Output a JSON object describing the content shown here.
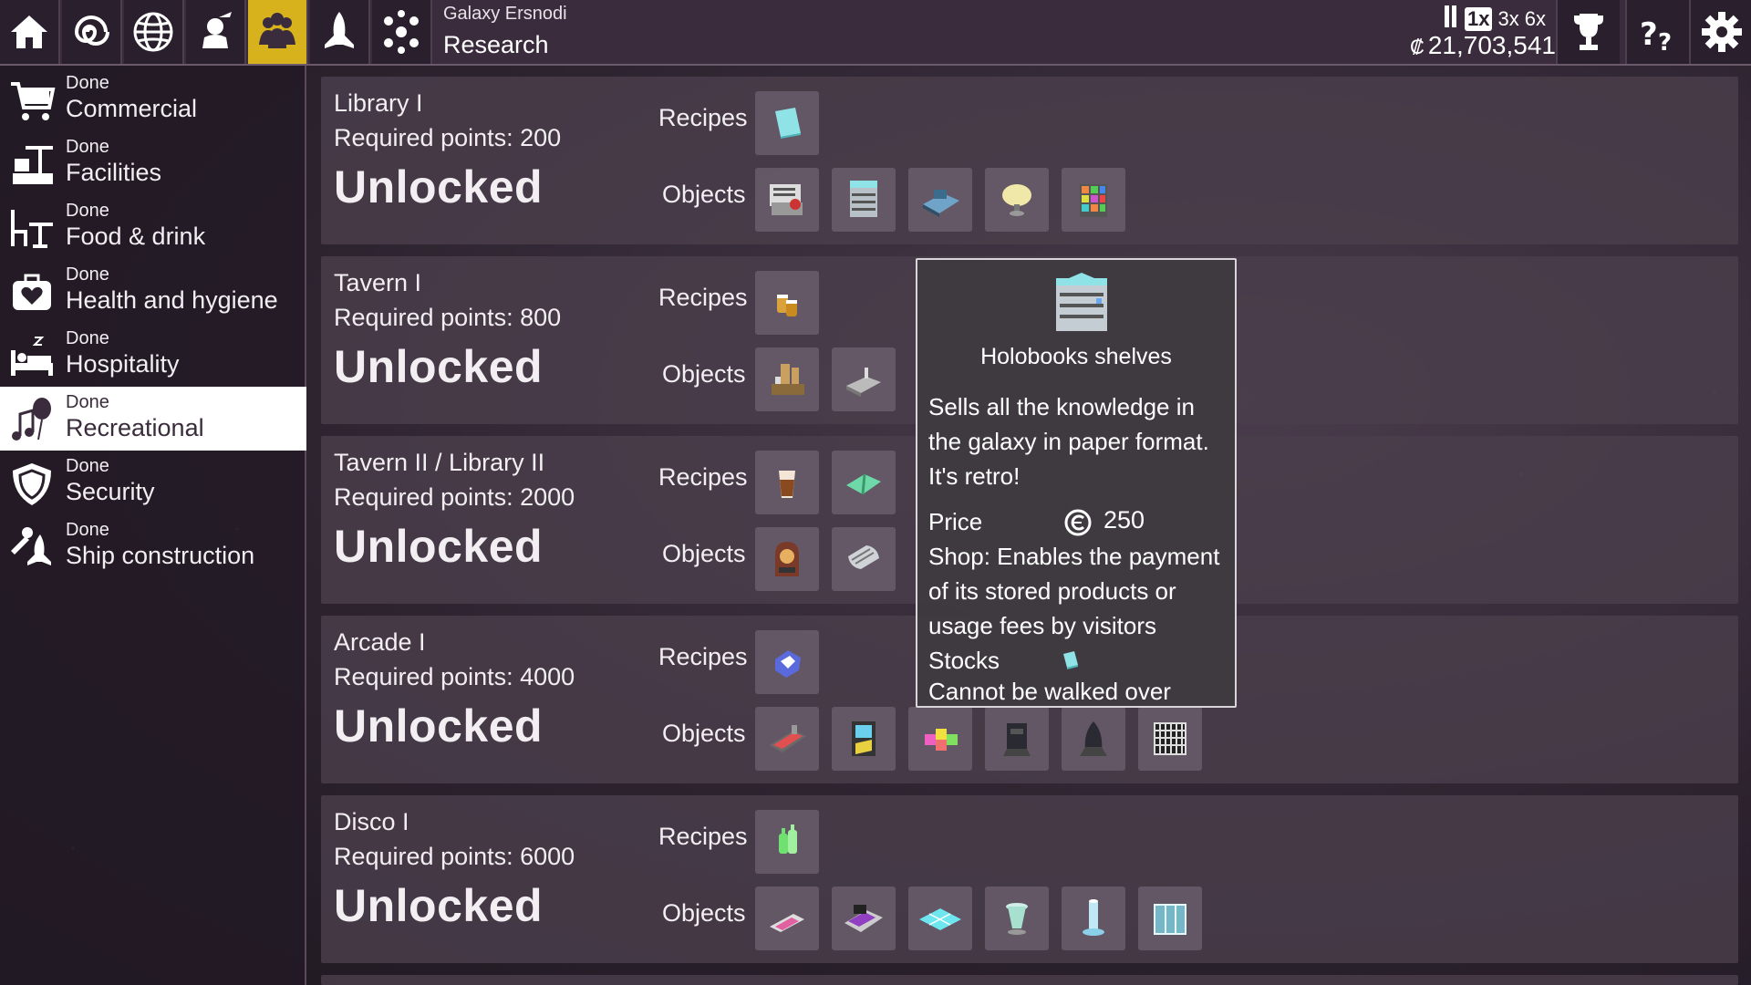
{
  "header": {
    "galaxy_name": "Galaxy Ersnodi",
    "screen_title": "Research",
    "speed": {
      "pause": "II",
      "options": [
        "1x",
        "3x",
        "6x"
      ],
      "selected": "1x"
    },
    "money": "21,703,541",
    "nav_icons": [
      "home-icon",
      "galaxy-spiral-icon",
      "globe-icon",
      "astronaut-icon",
      "crew-icon",
      "ship-icon",
      "network-icon"
    ],
    "active_nav": "crew-icon",
    "accent_color": "#d7b21d"
  },
  "sidebar": {
    "items": [
      {
        "status": "Done",
        "label": "Commercial",
        "icon": "cart-icon"
      },
      {
        "status": "Done",
        "label": "Facilities",
        "icon": "facilities-icon"
      },
      {
        "status": "Done",
        "label": "Food & drink",
        "icon": "table-chair-icon"
      },
      {
        "status": "Done",
        "label": "Health and hygiene",
        "icon": "medkit-icon"
      },
      {
        "status": "Done",
        "label": "Hospitality",
        "icon": "bed-icon"
      },
      {
        "status": "Done",
        "label": "Recreational",
        "icon": "music-balloon-icon",
        "selected": true
      },
      {
        "status": "Done",
        "label": "Security",
        "icon": "shield-icon"
      },
      {
        "status": "Done",
        "label": "Ship construction",
        "icon": "wrench-ship-icon"
      }
    ]
  },
  "research": {
    "recipes_label": "Recipes",
    "objects_label": "Objects",
    "rows": [
      {
        "name": "Library I",
        "points": "Required points: 200",
        "status": "Unlocked",
        "recipes": [
          "book-recipe-icon"
        ],
        "objects": [
          "bookstore-counter-icon",
          "holobooks-shelves-icon",
          "reading-desk-icon",
          "lamp-icon",
          "cube-shelf-icon"
        ]
      },
      {
        "name": "Tavern I",
        "points": "Required points: 800",
        "status": "Unlocked",
        "recipes": [
          "beer-mugs-icon"
        ],
        "objects": [
          "beer-tap-icon",
          "bar-counter-icon"
        ]
      },
      {
        "name": "Tavern II / Library II",
        "points": "Required points: 2000",
        "status": "Unlocked",
        "recipes": [
          "cocktail-icon",
          "green-book-icon"
        ],
        "objects": [
          "jukebox-icon",
          "pipe-barrel-icon"
        ]
      },
      {
        "name": "Arcade I",
        "points": "Required points: 4000",
        "status": "Unlocked",
        "recipes": [
          "token-icon"
        ],
        "objects": [
          "pinball-icon",
          "arcade-cabinet-icon",
          "cube-toy-icon",
          "robot-stand-icon",
          "rocket-stand-icon",
          "cage-icon"
        ]
      },
      {
        "name": "Disco I",
        "points": "Required points: 6000",
        "status": "Unlocked",
        "recipes": [
          "drink-bottles-icon"
        ],
        "objects": [
          "dj-pad-icon",
          "dj-deck-icon",
          "dance-floor-icon",
          "glass-table-icon",
          "light-pillar-icon",
          "glass-booth-icon"
        ]
      }
    ]
  },
  "tooltip": {
    "icon": "holobooks-shelves-icon",
    "title": "Holobooks shelves",
    "description": "Sells all the knowledge in the galaxy in paper format. It's retro!",
    "price_label": "Price",
    "price": "250",
    "shop_text": "Shop: Enables the payment of its stored products or usage fees by visitors",
    "stocks_label": "Stocks",
    "stocks_icon": "book-recipe-icon",
    "walk_text": "Cannot be walked over"
  }
}
